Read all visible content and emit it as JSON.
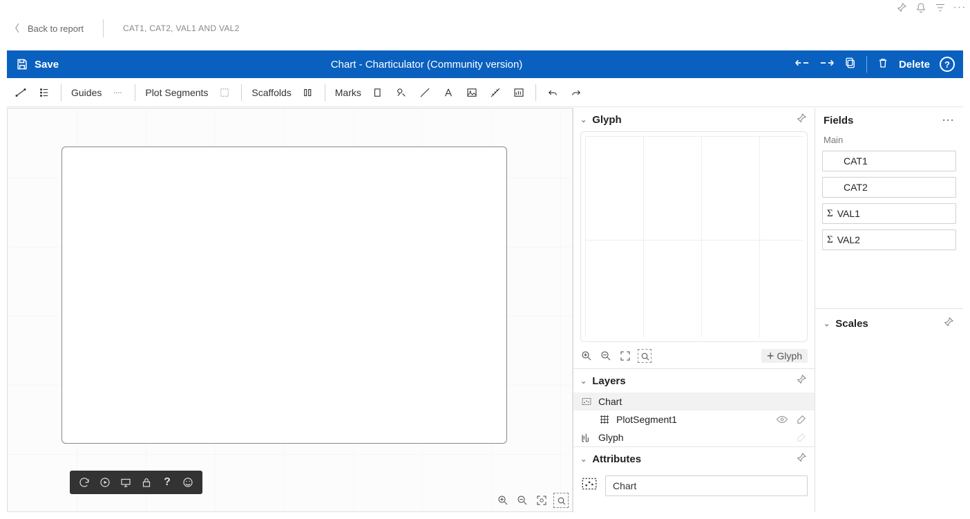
{
  "breadcrumb": {
    "back": "Back to report",
    "title": "CAT1, CAT2, VAL1 AND VAL2"
  },
  "bluebar": {
    "save": "Save",
    "title": "Chart - Charticulator (Community version)",
    "delete": "Delete"
  },
  "toolbar": {
    "guides": "Guides",
    "plotSegments": "Plot Segments",
    "scaffolds": "Scaffolds",
    "marks": "Marks"
  },
  "panels": {
    "glyph": "Glyph",
    "layers": "Layers",
    "attributes": "Attributes",
    "fields": "Fields",
    "scales": "Scales"
  },
  "glyph": {
    "addLabel": "Glyph"
  },
  "layers": {
    "items": [
      {
        "name": "Chart"
      },
      {
        "name": "PlotSegment1"
      },
      {
        "name": "Glyph"
      }
    ]
  },
  "attributes": {
    "chartName": "Chart"
  },
  "fields": {
    "section": "Main",
    "items": [
      {
        "label": "CAT1",
        "agg": null
      },
      {
        "label": "CAT2",
        "agg": null
      },
      {
        "label": "VAL1",
        "agg": "Σ"
      },
      {
        "label": "VAL2",
        "agg": "Σ"
      }
    ]
  }
}
